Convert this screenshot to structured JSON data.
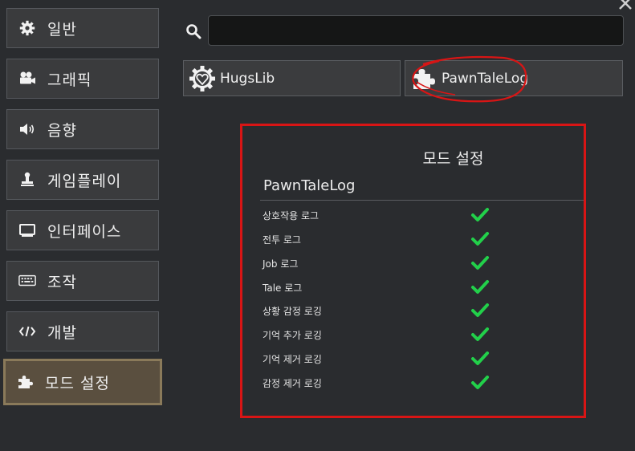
{
  "sidebar": {
    "items": [
      {
        "label": "일반",
        "icon": "gear-icon"
      },
      {
        "label": "그래픽",
        "icon": "video-camera-icon"
      },
      {
        "label": "음향",
        "icon": "speaker-icon"
      },
      {
        "label": "게임플레이",
        "icon": "stamp-icon"
      },
      {
        "label": "인터페이스",
        "icon": "monitor-icon"
      },
      {
        "label": "조작",
        "icon": "keyboard-icon"
      },
      {
        "label": "개발",
        "icon": "code-icon"
      },
      {
        "label": "모드 설정",
        "icon": "puzzle-icon",
        "active": true
      }
    ]
  },
  "search": {
    "value": "",
    "placeholder": ""
  },
  "mod_tabs": [
    {
      "label": "HugsLib",
      "icon": "heart-gear-icon"
    },
    {
      "label": "PawnTaleLog",
      "icon": "puzzle-icon",
      "annotated": true
    }
  ],
  "panel": {
    "title": "모드 설정",
    "subtitle": "PawnTaleLog",
    "settings": [
      {
        "label": "상호작용 로그",
        "checked": true
      },
      {
        "label": "전투 로그",
        "checked": true
      },
      {
        "label": "Job 로그",
        "checked": true
      },
      {
        "label": "Tale 로그",
        "checked": true
      },
      {
        "label": "상황 감정 로깅",
        "checked": true
      },
      {
        "label": "기억 추가 로깅",
        "checked": true
      },
      {
        "label": "기억 제거 로깅",
        "checked": true
      },
      {
        "label": "감정 제거 로깅",
        "checked": true
      }
    ]
  },
  "colors": {
    "annotation_red": "#d81515",
    "check_green": "#22d04a",
    "active_tab": "#5a4f3f"
  }
}
